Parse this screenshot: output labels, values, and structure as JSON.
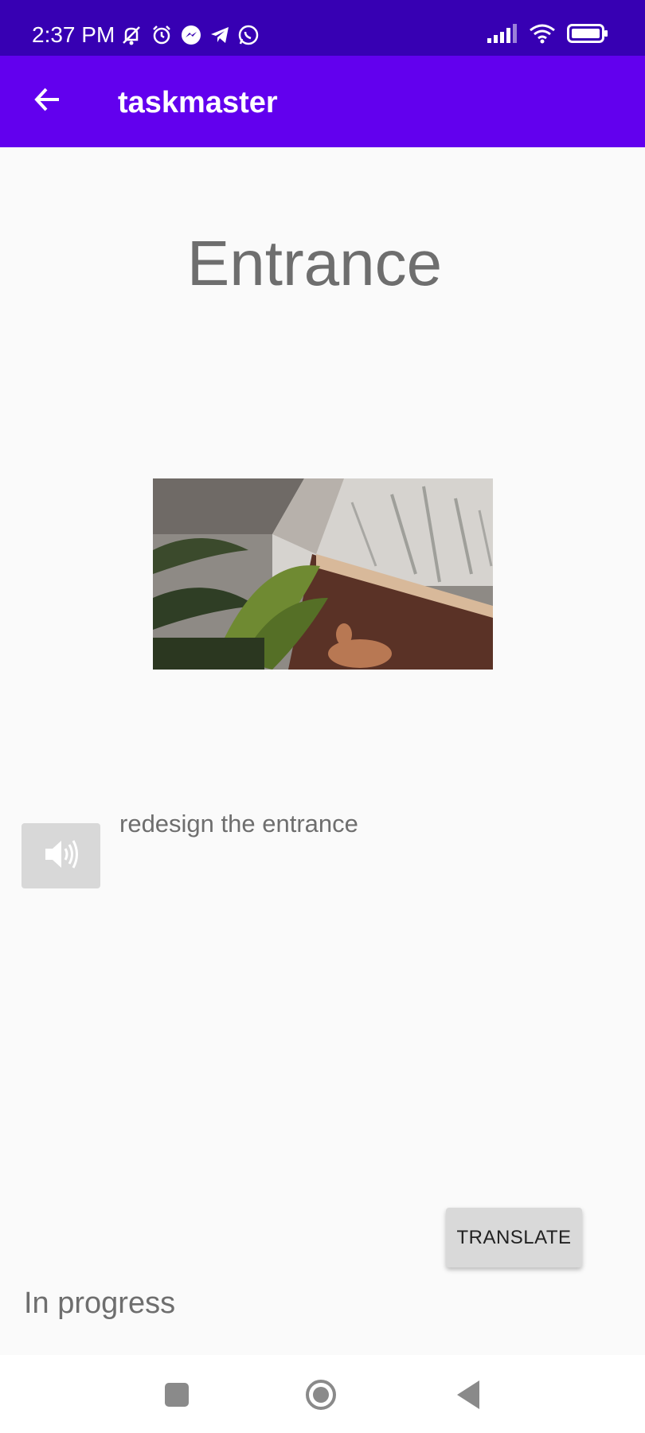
{
  "status_bar": {
    "time": "2:37 PM",
    "icons_left": [
      "muted-bell-icon",
      "alarm-icon",
      "messenger-icon",
      "telegram-icon",
      "whatsapp-icon"
    ],
    "icons_right": [
      "signal-icon",
      "wifi-icon",
      "battery-icon"
    ]
  },
  "app_bar": {
    "title": "taskmaster",
    "back_icon": "arrow-back-icon",
    "color": "#6200EE"
  },
  "task": {
    "title": "Entrance",
    "image_alt": "entrance-photo",
    "description": "redesign the entrance",
    "status": "In progress"
  },
  "buttons": {
    "speak_icon": "speaker-icon",
    "translate_label": "TRANSLATE"
  },
  "nav_bar": {
    "items": [
      "recents-square-icon",
      "home-circle-icon",
      "back-triangle-icon"
    ]
  },
  "colors": {
    "status_bar": "#3700B3",
    "app_bar": "#6200EE",
    "background": "#FAFAFA"
  }
}
